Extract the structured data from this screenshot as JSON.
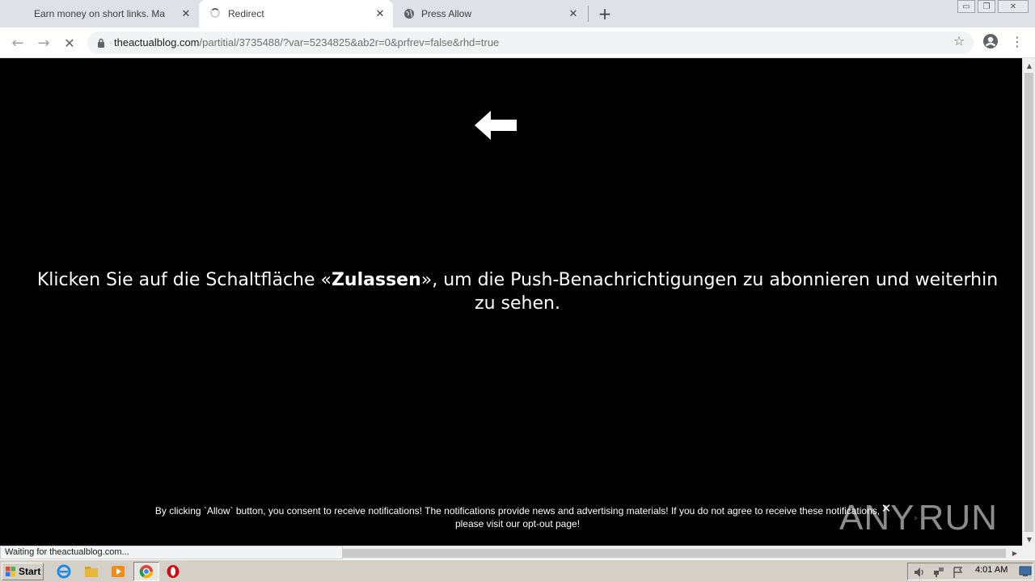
{
  "window": {
    "minimize_glyph": "▭",
    "restore_glyph": "❐",
    "close_glyph": "✕"
  },
  "tabs": [
    {
      "title": "Earn money on short links. Make sho",
      "close": "✕",
      "icon": "none"
    },
    {
      "title": "Redirect",
      "close": "✕",
      "icon": "loading-spinner",
      "active": true
    },
    {
      "title": "Press Allow",
      "close": "✕",
      "icon": "globe-icon"
    }
  ],
  "new_tab": "+",
  "toolbar": {
    "back": "←",
    "forward": "→",
    "stop": "✕",
    "url_domain": "theactualblog.com",
    "url_path": "/partitial/3735488/?var=5234825&ab2r=0&prfrev=false&rhd=true",
    "star": "☆",
    "menu": "⋮"
  },
  "content": {
    "headline_before": "Klicken Sie auf die Schaltfläche «",
    "headline_bold": "Zulassen",
    "headline_after": "», um die Push-Benachrichtigungen zu abonnieren und weiterhin zu sehen.",
    "consent_line1": "By clicking `Allow` button, you consent to receive notifications! The notifications provide news and advertising materials! If you do not agree to receive these notifications,",
    "consent_line2_before": "please visit our ",
    "consent_link": "opt-out page",
    "consent_line2_after": "!",
    "consent_close": "✕",
    "watermark_left": "ANY",
    "watermark_right": "RUN"
  },
  "status": {
    "text": "Waiting for theactualblog.com..."
  },
  "taskbar": {
    "start_label": "Start",
    "clock": "4:01 AM",
    "accent_colors": {
      "ie": "#1e88e5",
      "folder": "#e8b83a",
      "media": "#f08c1a",
      "chrome_red": "#db4437",
      "opera": "#cc0f16"
    }
  }
}
